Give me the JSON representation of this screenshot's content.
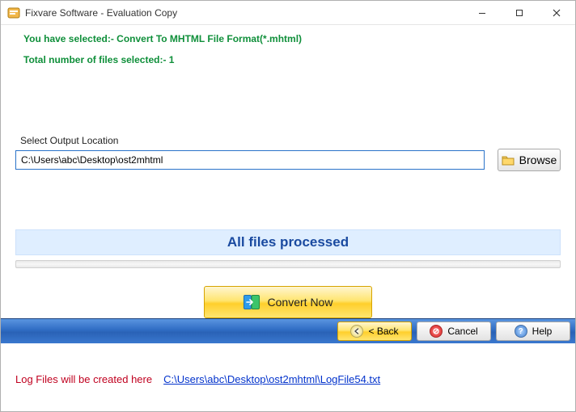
{
  "window": {
    "title": "Fixvare Software - Evaluation Copy"
  },
  "info": {
    "selected_line": "You have selected:- Convert To MHTML File Format(*.mhtml)",
    "count_line": "Total number of files selected:- 1"
  },
  "output": {
    "label": "Select Output Location",
    "path": "C:\\Users\\abc\\Desktop\\ost2mhtml",
    "browse_label": "Browse"
  },
  "status": {
    "text": "All files processed"
  },
  "convert": {
    "label": "Convert Now"
  },
  "log": {
    "label": "Log Files will be created here",
    "link_text": "C:\\Users\\abc\\Desktop\\ost2mhtml\\LogFile54.txt"
  },
  "footer": {
    "back": "< Back",
    "cancel": "Cancel",
    "help": "Help"
  }
}
